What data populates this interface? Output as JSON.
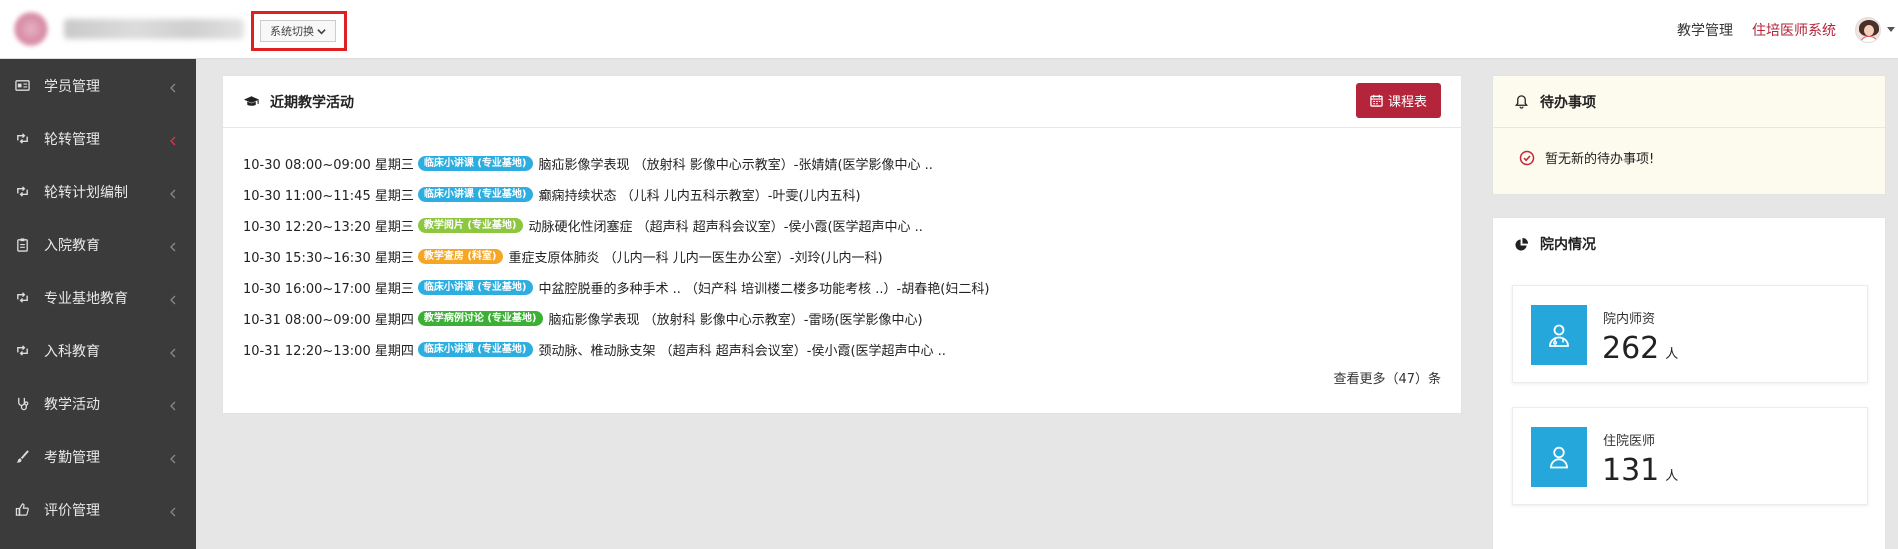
{
  "header": {
    "system_switch_label": "系统切换",
    "links": [
      "教学管理",
      "住培医师系统"
    ]
  },
  "sidebar": {
    "items": [
      {
        "label": "学员管理",
        "icon": "id-card-icon"
      },
      {
        "label": "轮转管理",
        "icon": "retweet-icon",
        "active": true
      },
      {
        "label": "轮转计划编制",
        "icon": "retweet-icon"
      },
      {
        "label": "入院教育",
        "icon": "clipboard-icon"
      },
      {
        "label": "专业基地教育",
        "icon": "retweet-icon"
      },
      {
        "label": "入科教育",
        "icon": "retweet-icon"
      },
      {
        "label": "教学活动",
        "icon": "stethoscope-icon"
      },
      {
        "label": "考勤管理",
        "icon": "brush-icon"
      },
      {
        "label": "评价管理",
        "icon": "thumbs-up-icon"
      }
    ]
  },
  "activities": {
    "title": "近期教学活动",
    "schedule_button": "课程表",
    "items": [
      {
        "time": "10-30 08:00~09:00 星期三",
        "badge": "临床小讲课 (专业基地)",
        "badge_color": "#2eaee0",
        "text": "脑疝影像学表现 （放射科  影像中心示教室）-张婧婧(医学影像中心 .."
      },
      {
        "time": "10-30 11:00~11:45 星期三",
        "badge": "临床小讲课 (专业基地)",
        "badge_color": "#2eaee0",
        "text": "癫痫持续状态 （儿科  儿内五科示教室）-叶雯(儿内五科)"
      },
      {
        "time": "10-30 12:20~13:20 星期三",
        "badge": "教学阅片 (专业基地)",
        "badge_color": "#8dc63f",
        "text": "动脉硬化性闭塞症 （超声科  超声科会议室）-侯小霞(医学超声中心 .."
      },
      {
        "time": "10-30 15:30~16:30 星期三",
        "badge": "教学查房 (科室)",
        "badge_color": "#f5a623",
        "text": "重症支原体肺炎 （儿内一科  儿内一医生办公室）-刘玲(儿内一科)"
      },
      {
        "time": "10-30 16:00~17:00 星期三",
        "badge": "临床小讲课 (专业基地)",
        "badge_color": "#2eaee0",
        "text": "中盆腔脱垂的多种手术 .. （妇产科  培训楼二楼多功能考核 ..）-胡春艳(妇二科)"
      },
      {
        "time": "10-31 08:00~09:00 星期四",
        "badge": "教学病例讨论 (专业基地)",
        "badge_color": "#3cb034",
        "text": "脑疝影像学表现 （放射科  影像中心示教室）-雷旸(医学影像中心)"
      },
      {
        "time": "10-31 12:20~13:00 星期四",
        "badge": "临床小讲课 (专业基地)",
        "badge_color": "#2eaee0",
        "text": "颈动脉、椎动脉支架 （超声科  超声科会议室）-侯小霞(医学超声中心 .."
      }
    ],
    "more_label": "查看更多（47）条"
  },
  "todo": {
    "title": "待办事项",
    "empty_text": "暂无新的待办事项!"
  },
  "stats": {
    "title": "院内情况",
    "cards": [
      {
        "label": "院内师资",
        "value": "262",
        "unit": "人",
        "icon": "user-doctor-icon"
      },
      {
        "label": "住院医师",
        "value": "131",
        "unit": "人",
        "icon": "user-icon"
      }
    ]
  },
  "colors": {
    "sidebar_bg": "#3b3b3b",
    "brand_red": "#b4243b",
    "stat_blue": "#26a7db"
  }
}
